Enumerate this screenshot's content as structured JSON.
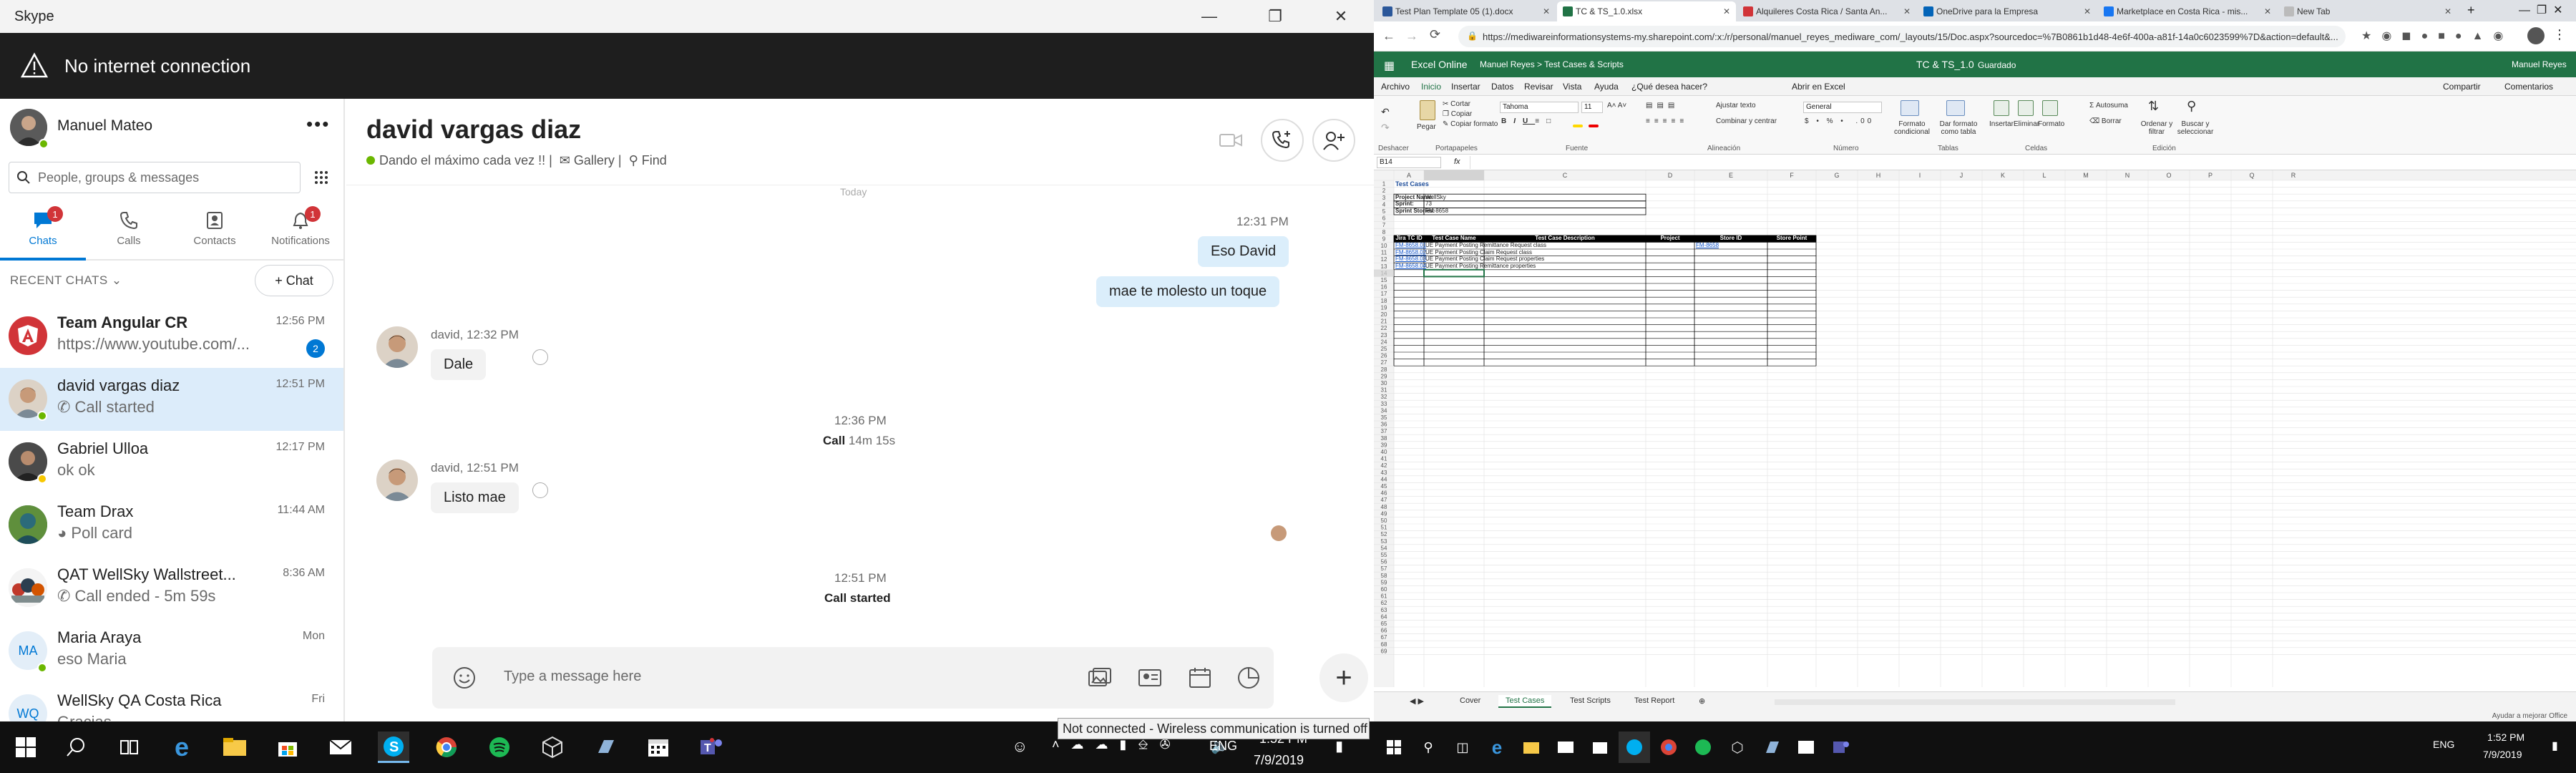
{
  "skype": {
    "window_title": "Skype",
    "banner": "No internet connection",
    "profile_name": "Manuel Mateo",
    "search_placeholder": "People, groups & messages",
    "nav": [
      {
        "label": "Chats",
        "badge": "1"
      },
      {
        "label": "Calls",
        "badge": ""
      },
      {
        "label": "Contacts",
        "badge": ""
      },
      {
        "label": "Notifications",
        "badge": "1"
      }
    ],
    "recent_label": "RECENT CHATS",
    "new_chat": "Chat",
    "chats": [
      {
        "name": "Team Angular CR",
        "preview": "https://www.youtube.com/...",
        "time": "12:56 PM",
        "count": "2"
      },
      {
        "name": "david vargas diaz",
        "preview": "Call started",
        "time": "12:51 PM",
        "count": ""
      },
      {
        "name": "Gabriel Ulloa",
        "preview": "ok ok",
        "time": "12:17 PM",
        "count": ""
      },
      {
        "name": "Team Drax",
        "preview": "Poll card",
        "time": "11:44 AM",
        "count": ""
      },
      {
        "name": "QAT WellSky Wallstreet...",
        "preview": "Call ended - 5m 59s",
        "time": "8:36 AM",
        "count": ""
      },
      {
        "name": "Maria Araya",
        "preview": "eso Maria",
        "time": "Mon",
        "count": "",
        "initials": "MA"
      },
      {
        "name": "WellSky QA Costa Rica",
        "preview": "Gracias",
        "time": "Fri",
        "count": "",
        "initials": "WQ"
      }
    ],
    "conversation": {
      "contact_name": "david vargas diaz",
      "mood": "Dando el máximo cada vez !! |",
      "gallery": "Gallery |",
      "find": "Find",
      "scrolled_text": "Today",
      "my_time": "12:31 PM",
      "msg1": "Eso David",
      "msg2": "mae te molesto un toque",
      "david_meta1": "david, 12:32 PM",
      "reply1": "Dale",
      "call_time": "12:36 PM",
      "call_label": "Call",
      "call_duration": "14m 15s",
      "david_meta2": "david, 12:51 PM",
      "reply2": "Listo mae",
      "started_time": "12:51 PM",
      "started_label": "Call started",
      "input_placeholder": "Type a message here"
    }
  },
  "browser": {
    "tabs": [
      {
        "label": "Test Plan Template 05 (1).docx",
        "color": "#2b579a"
      },
      {
        "label": "TC & TS_1.0.xlsx",
        "color": "#217346"
      },
      {
        "label": "Alquileres Costa Rica / Santa An...",
        "color": "#d13438"
      },
      {
        "label": "OneDrive para la Empresa",
        "color": "#0364b8"
      },
      {
        "label": "Marketplace en Costa Rica - mis...",
        "color": "#1877f2"
      },
      {
        "label": "New Tab",
        "color": "#bbbbbb"
      }
    ],
    "url": "https://mediwareinformationsystems-my.sharepoint.com/:x:/r/personal/manuel_reyes_mediware_com/_layouts/15/Doc.aspx?sourcedoc=%7B0861b1d48-4e6f-400a-a81f-14a0c6023599%7D&action=default&..."
  },
  "excel": {
    "app": "Excel Online",
    "breadcrumb": "Manuel Reyes  >  Test Cases & Scripts",
    "doc_title": "TC & TS_1.0",
    "saved": "Guardado",
    "user": "Manuel Reyes",
    "menu": [
      "Archivo",
      "Inicio",
      "Insertar",
      "Datos",
      "Revisar",
      "Vista",
      "Ayuda",
      "¿Qué desea hacer?",
      "Abrir en Excel"
    ],
    "share": "Compartir",
    "comments": "Comentarios",
    "ribbon": {
      "paste": "Pegar",
      "cut": "Cortar",
      "copy": "Copiar",
      "format_painter": "Copiar formato",
      "font": "Tahoma",
      "size": "11",
      "wrap": "Ajustar texto",
      "merge": "Combinar y centrar",
      "number_format": "General",
      "cond_format": "Formato condicional",
      "format_table": "Dar formato como tabla",
      "insert": "Insertar",
      "delete": "Eliminar",
      "format": "Formato",
      "autosum": "Autosuma",
      "clear": "Borrar",
      "sort": "Ordenar y filtrar",
      "find": "Buscar y seleccionar",
      "groups": [
        "Deshacer",
        "Portapapeles",
        "Fuente",
        "Alineación",
        "Número",
        "Tablas",
        "Celdas",
        "Edición"
      ]
    },
    "name_box": "B14",
    "fx": "fx",
    "columns": [
      "A",
      "B",
      "C",
      "D",
      "E",
      "F",
      "G",
      "H",
      "I",
      "J",
      "K",
      "L",
      "M",
      "N",
      "O",
      "P",
      "Q",
      "R"
    ],
    "sheet_title": "Test Cases",
    "project_label": "Project Name:",
    "project_value": "WellSky",
    "sprint_label": "Sprint:",
    "sprint_value": "73",
    "story_label": "Sprint Stories:",
    "story_value": "FM-8658",
    "headers": [
      "Jira TC ID",
      "Test Case Name",
      "Test Case Description",
      "Project",
      "Store ID",
      "Store Point"
    ],
    "rows": [
      {
        "id": "FM-8658.01",
        "name": "UE Payment Posting Remittance Request class",
        "story": "FM-8658"
      },
      {
        "id": "FM-8658.02",
        "name": "UE Payment Posting Claim Request class",
        "story": ""
      },
      {
        "id": "FM-8658.03",
        "name": "UE Payment Posting Claim Request properties",
        "story": ""
      },
      {
        "id": "FM-8658.04",
        "name": "UE Payment Posting Remittance properties",
        "story": ""
      }
    ],
    "sheet_tabs": [
      "Cover",
      "Test Cases",
      "Test Scripts",
      "Test Report"
    ],
    "active_sheet": "Test Cases",
    "status_help": "Ayudar a mejorar Office"
  },
  "taskbar": {
    "tooltip": "Not connected - Wireless communication is turned off",
    "lang": "ENG",
    "time": "1:52 PM",
    "date": "7/9/2019",
    "lang2": "ENG",
    "time2": "1:52 PM",
    "date2": "7/9/2019"
  }
}
